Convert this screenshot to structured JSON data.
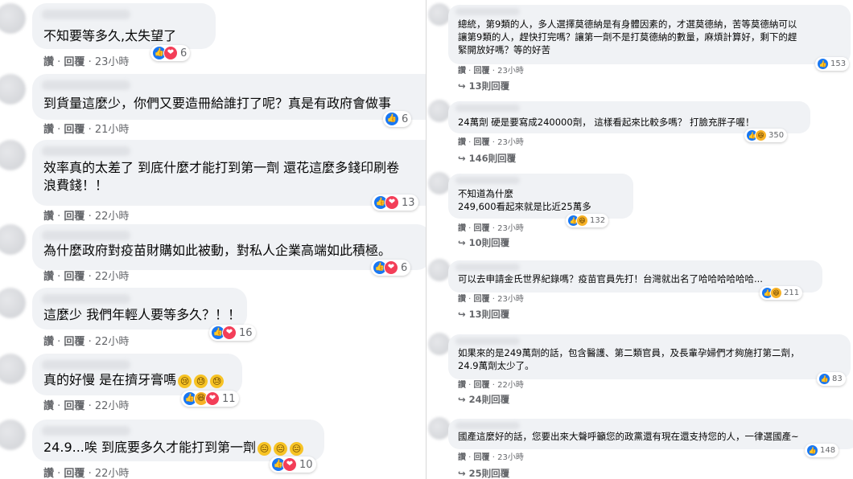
{
  "meta_labels": {
    "like": "讚",
    "sep": " · ",
    "reply": "回覆",
    "dot": " · "
  },
  "left_comments": [
    {
      "text": "不知要等多久,太失望了",
      "time": "23小時",
      "reactions": [
        "like",
        "love"
      ],
      "count": "6"
    },
    {
      "text": "到貨量這麼少，你們又要造冊給誰打了呢？真是有政府會做事",
      "time": "21小時",
      "reactions": [
        "like"
      ],
      "count": "6"
    },
    {
      "text": "效率真的太差了 到底什麼才能打到第一劑 還花這麼多錢印刷卷\n浪費錢！！",
      "time": "22小時",
      "reactions": [
        "like",
        "love"
      ],
      "count": "13"
    },
    {
      "text": "為什麼政府對疫苗財購如此被動，對私人企業高端如此積極。",
      "time": "22小時",
      "reactions": [
        "like",
        "love"
      ],
      "count": "6"
    },
    {
      "text": "這麼少 我們年輕人要等多久？！！",
      "time": "22小時",
      "reactions": [
        "like",
        "love"
      ],
      "count": "16"
    },
    {
      "text": "真的好慢 是在擠牙膏嗎",
      "emojis": [
        "😢",
        "😓",
        "😓"
      ],
      "time": "22小時",
      "reactions": [
        "like",
        "haha",
        "love"
      ],
      "count": "11"
    },
    {
      "text": "24.9...唉 到底要多久才能打到第一劑",
      "emojis": [
        "😑",
        "😑",
        "😑"
      ],
      "time": "22小時",
      "reactions": [
        "like",
        "love"
      ],
      "count": "10"
    }
  ],
  "right_comments": [
    {
      "text": "總統，第9類的人，多人選擇莫德納是有身體因素的，才選莫德納，苦等莫德納可以\n讓第9類的人，趕快打完嗎？讓第一劑不是打莫德納的數量，麻煩計算好，剩下的趕\n緊開放好嗎？等的好苦",
      "time": "23小時",
      "reactions": [
        "like"
      ],
      "count": "153",
      "replies": "↪ 13則回覆"
    },
    {
      "text": "24萬劑 硬是要寫成240000劑， 這樣看起來比較多嗎？ 打臉充胖子喔！",
      "time": "23小時",
      "reactions": [
        "like",
        "haha"
      ],
      "count": "350",
      "replies": "↪ 146則回覆"
    },
    {
      "text": "不知道為什麼\n249,600看起來就是比近25萬多",
      "time": "23小時",
      "reactions": [
        "like",
        "haha"
      ],
      "count": "132",
      "replies": "↪ 10則回覆"
    },
    {
      "text": "可以去申請金氏世界紀錄嗎？疫苗官員先打！台灣就出名了哈哈哈哈哈哈...",
      "time": "23小時",
      "reactions": [
        "like",
        "haha"
      ],
      "count": "211",
      "replies": "↪ 13則回覆"
    },
    {
      "text": "如果來的是249萬劑的話，包含醫護、第二類官員，及長輩孕婦們才夠施打第二劑，\n24.9萬劑太少了。",
      "time": "22小時",
      "reactions": [
        "like"
      ],
      "count": "83",
      "replies": "↪ 24則回覆"
    },
    {
      "text": "國產這麼好的話，您要出來大聲呼籲您的政黨還有現在還支持您的人，一律選國產~",
      "time": "23小時",
      "reactions": [
        "like"
      ],
      "count": "148",
      "replies": "↪ 25則回覆"
    }
  ],
  "icons": {
    "like": "👍",
    "love": "❤",
    "haha": "😆"
  },
  "colors": {
    "like": "#1877f2",
    "love": "#f33e58",
    "haha": "#f7b125",
    "bubble": "#f0f2f5",
    "meta": "#65676b"
  }
}
